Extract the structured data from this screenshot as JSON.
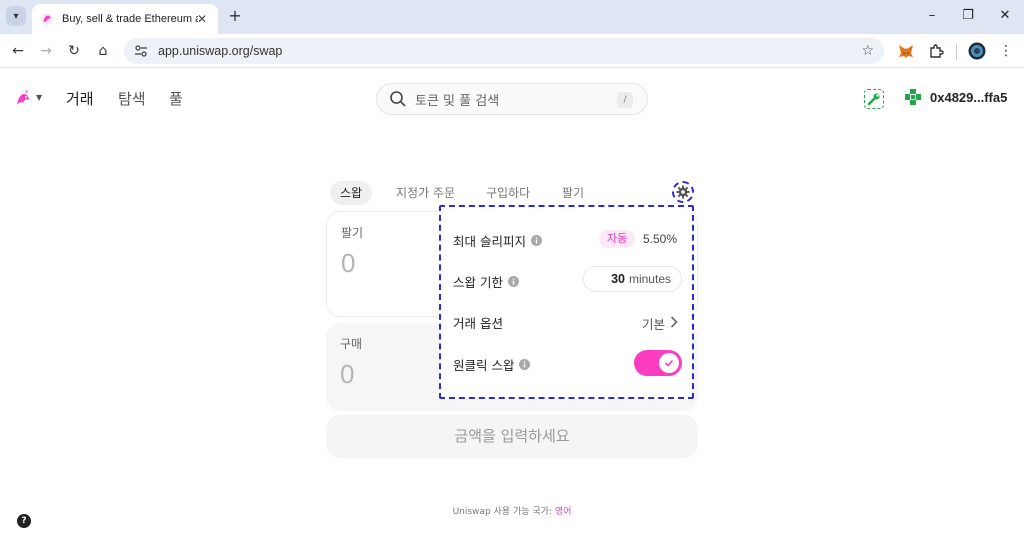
{
  "browser": {
    "tab_title": "Buy, sell & trade Ethereum and",
    "url": "app.uniswap.org/swap",
    "icons": [
      "tab-list-icon",
      "close-icon",
      "new-tab-icon",
      "minimize-icon",
      "restore-icon",
      "window-close-icon",
      "back-icon",
      "forward-icon",
      "reload-icon",
      "home-icon",
      "site-info-icon",
      "star-icon",
      "metamask-icon",
      "puzzle-icon",
      "profile-icon",
      "kebab-menu-icon"
    ]
  },
  "header": {
    "nav": [
      "거래",
      "탐색",
      "풀"
    ],
    "search_placeholder": "토큰 및 풀 검색",
    "search_shortcut": "/",
    "wallet_address": "0x4829...ffa5"
  },
  "swap": {
    "tabs": [
      "스왑",
      "지정가 주문",
      "구입하다",
      "팔기"
    ],
    "sell_label": "팔기",
    "sell_amount": "0",
    "buy_label": "구매",
    "buy_amount": "0",
    "cta_label": "금액을 입력하세요"
  },
  "settings": {
    "max_slippage_label": "최대 슬리피지",
    "slippage_mode": "자동",
    "slippage_value": "5.50%",
    "deadline_label": "스왑 기한",
    "deadline_value": "30",
    "deadline_unit": "minutes",
    "trade_options_label": "거래 옵션",
    "trade_options_value": "기본",
    "one_click_label": "원클릭 스왑",
    "one_click_enabled": true
  },
  "footer": {
    "prefix": "Uniswap 사용 가능 국가:",
    "link": "영어",
    "help": "?"
  },
  "colors": {
    "accent_pink": "#fc3dbf",
    "highlight_blue": "#2a2ad8",
    "tool_green": "#21a64a"
  }
}
